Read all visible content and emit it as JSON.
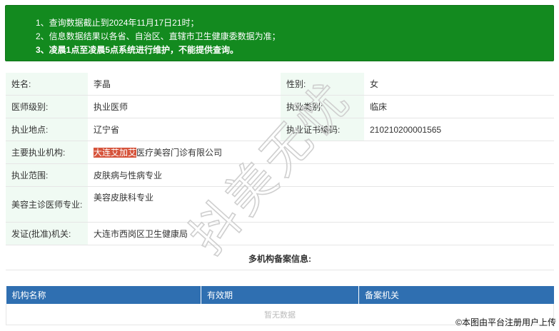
{
  "notice": {
    "line1": "1、查询数据截止到2024年11月17日21时；",
    "line2": "2、信息数据结果以各省、自治区、直辖市卫生健康委数据为准；",
    "line3": "3、凌晨1点至凌晨5点系统进行维护，不能提供查询。"
  },
  "info": {
    "name_label": "姓名:",
    "name_value": "李晶",
    "gender_label": "性别:",
    "gender_value": "女",
    "level_label": "医师级别:",
    "level_value": "执业医师",
    "category_label": "执业类别:",
    "category_value": "临床",
    "location_label": "执业地点:",
    "location_value": "辽宁省",
    "cert_label": "执业证书编码:",
    "cert_value": "210210200001565",
    "org_label": "主要执业机构:",
    "org_highlight": "大连艾加艾",
    "org_rest": "医疗美容门诊有限公司",
    "scope_label": "执业范围:",
    "scope_value": "皮肤病与性病专业",
    "cosmetic_label": "美容主诊医师专业:",
    "cosmetic_value": "美容皮肤科专业",
    "issuer_label": "发证(批准)机关:",
    "issuer_value": "大连市西岗区卫生健康局"
  },
  "multi": {
    "title": "多机构备案信息:",
    "columns": [
      "机构名称",
      "有效期",
      "备案机关"
    ],
    "empty_text": "暂无数据"
  },
  "watermark": {
    "text": "抖美无忧"
  },
  "copyright": "©本图由平台注册用户上传",
  "colors": {
    "notice_bg": "#138a1f",
    "label_bg": "#f0faf3",
    "table_header": "#2f6fb1",
    "highlight": "#d6543c"
  }
}
